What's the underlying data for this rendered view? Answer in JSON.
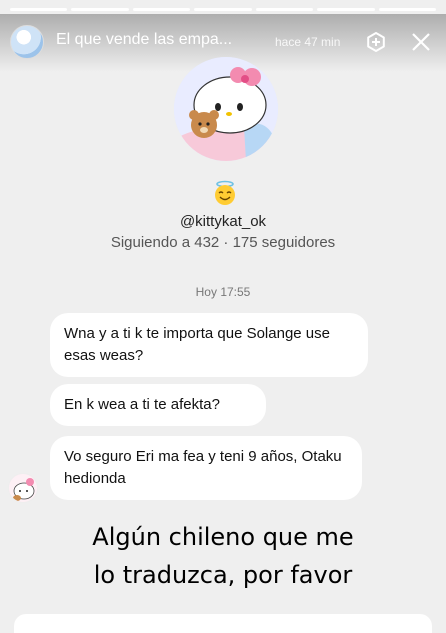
{
  "story": {
    "title": "El que vende las empa...",
    "time": "hace 47 min",
    "add_icon": "add-circle-icon",
    "close_icon": "close-icon",
    "segments": 7
  },
  "profile": {
    "emoji": "angel-emoji",
    "username": "@kittykat_ok",
    "stats": "Siguiendo a 432 · 175 seguidores"
  },
  "chat": {
    "date": "Hoy 17:55",
    "messages": [
      {
        "text": "Wna y a ti k te importa que Solange use esas weas?"
      },
      {
        "text": "En k wea a ti te afekta?"
      },
      {
        "text": "Vo seguro Eri ma fea y teni 9 años, Otaku hedionda"
      }
    ]
  },
  "caption": {
    "line1": "Algún chileno que me",
    "line2": "lo traduzca, por favor"
  },
  "colors": {
    "background": "#efefef",
    "bubble": "#ffffff"
  }
}
